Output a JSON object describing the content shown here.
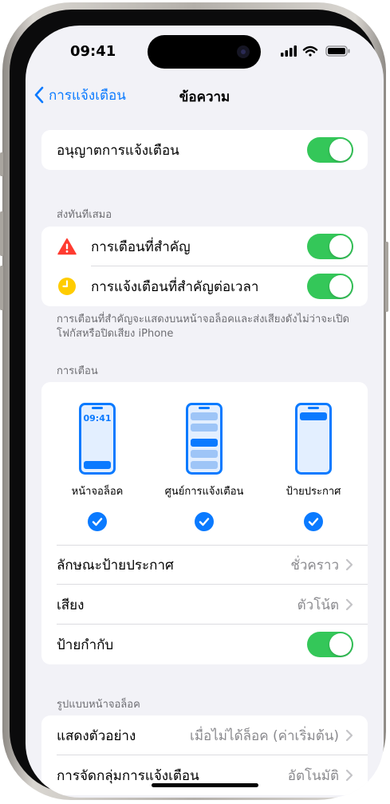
{
  "status_bar": {
    "time": "09:41"
  },
  "nav": {
    "back_label": "การแจ้งเตือน",
    "title": "ข้อความ"
  },
  "allow": {
    "label": "อนุญาตการแจ้งเตือน",
    "enabled": true
  },
  "always_deliver": {
    "header": "ส่งทันทีเสมอ",
    "rows": [
      {
        "label": "การเตือนที่สำคัญ",
        "icon": "warning-triangle-icon",
        "color": "#ff3b30",
        "enabled": true
      },
      {
        "label": "การแจ้งเตือนที่สำคัญต่อเวลา",
        "icon": "clock-icon",
        "color": "#ffcc00",
        "enabled": true
      }
    ],
    "footnote": "การเตือนที่สำคัญจะแสดงบนหน้าจอล็อคและส่งเสียงดังไม่ว่าจะเปิดโฟกัสหรือปิดเสียง iPhone"
  },
  "alerts": {
    "header": "การเตือน",
    "styles": [
      {
        "label": "หน้าจอล็อค",
        "preview_time": "09:41",
        "selected": true
      },
      {
        "label": "ศูนย์การแจ้งเตือน",
        "selected": true
      },
      {
        "label": "ป้ายประกาศ",
        "selected": true
      }
    ],
    "banner_style": {
      "label": "ลักษณะป้ายประกาศ",
      "value": "ชั่วคราว"
    },
    "sound": {
      "label": "เสียง",
      "value": "ตัวโน้ต"
    },
    "badges": {
      "label": "ป้ายกำกับ",
      "enabled": true
    }
  },
  "lock_screen": {
    "header": "รูปแบบหน้าจอล็อค",
    "show_previews": {
      "label": "แสดงตัวอย่าง",
      "value": "เมื่อไม่ได้ล็อค (ค่าเริ่มต้น)"
    },
    "grouping": {
      "label": "การจัดกลุ่มการแจ้งเตือน",
      "value": "อัตโนมัติ"
    }
  },
  "colors": {
    "accent": "#0a7aff",
    "toggle_on": "#34c759",
    "background": "#f2f2f7"
  }
}
